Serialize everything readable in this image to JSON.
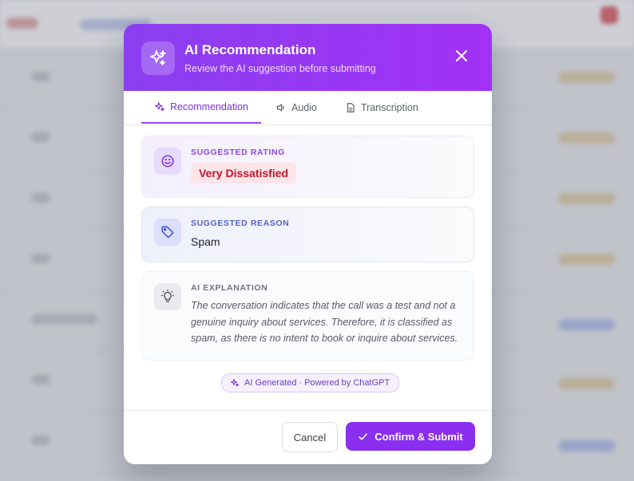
{
  "modal": {
    "title": "AI Recommendation",
    "subtitle": "Review the AI suggestion before submitting"
  },
  "tabs": [
    {
      "label": "Recommendation",
      "icon": "sparkles-icon",
      "active": true
    },
    {
      "label": "Audio",
      "icon": "speaker-icon",
      "active": false
    },
    {
      "label": "Transcription",
      "icon": "document-icon",
      "active": false
    }
  ],
  "rating": {
    "label": "SUGGESTED RATING",
    "value": "Very Dissatisfied",
    "icon": "smiley-icon"
  },
  "reason": {
    "label": "SUGGESTED REASON",
    "value": "Spam",
    "icon": "tag-icon"
  },
  "explanation": {
    "label": "AI EXPLANATION",
    "text": "The conversation indicates that the call was a test and not a genuine inquiry about services. Therefore, it is classified as spam, as there is no intent to book or inquire about services.",
    "icon": "lightbulb-icon"
  },
  "ai_badge": "AI Generated · Powered by ChatGPT",
  "footer": {
    "cancel_label": "Cancel",
    "confirm_label": "Confirm & Submit"
  },
  "colors": {
    "accent": "#8a2ff0",
    "danger": "#c0182c"
  }
}
